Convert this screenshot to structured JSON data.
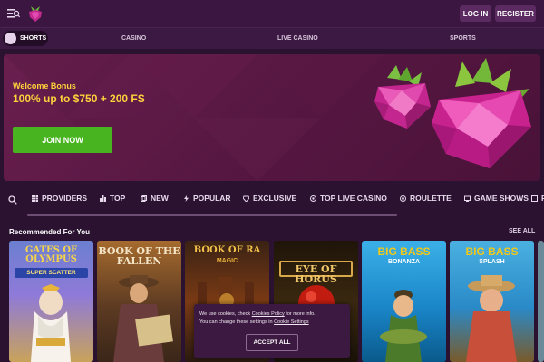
{
  "header": {
    "login": "LOG IN",
    "register": "REGISTER"
  },
  "nav": {
    "shorts": "SHORTS",
    "items": [
      "CASINO",
      "LIVE CASINO",
      "SPORTS"
    ]
  },
  "hero": {
    "line1": "Welcome Bonus",
    "line2": "100% up to $750 + 200 FS",
    "cta": "JOIN NOW"
  },
  "categories": [
    "PROVIDERS",
    "TOP",
    "NEW",
    "POPULAR",
    "EXCLUSIVE",
    "TOP LIVE CASINO",
    "ROULETTE",
    "GAME SHOWS",
    "FE"
  ],
  "recommended": {
    "title": "Recommended For You",
    "see_all": "SEE ALL"
  },
  "games": [
    {
      "title": "GATES OF OLYMPUS",
      "sub": "SUPER SCATTER"
    },
    {
      "title": "BOOK OF THE FALLEN",
      "sub": ""
    },
    {
      "title": "BOOK OF RA",
      "sub": "MAGIC"
    },
    {
      "title": "EYE OF HORUS",
      "sub": ""
    },
    {
      "title": "BIG BASS",
      "sub": "BONANZA"
    },
    {
      "title": "BIG BASS",
      "sub": "SPLASH"
    }
  ],
  "cookie": {
    "line1_a": "We use cookies, check ",
    "link1": "Cookies Policy",
    "line1_b": " for more info.",
    "line2_a": "You can change these settings in ",
    "link2": "Cookie Settings",
    "accept": "ACCEPT ALL"
  },
  "colors": {
    "accent_green": "#48b41f",
    "bonus_yellow": "#ffd23c",
    "bg": "#2a1230"
  }
}
